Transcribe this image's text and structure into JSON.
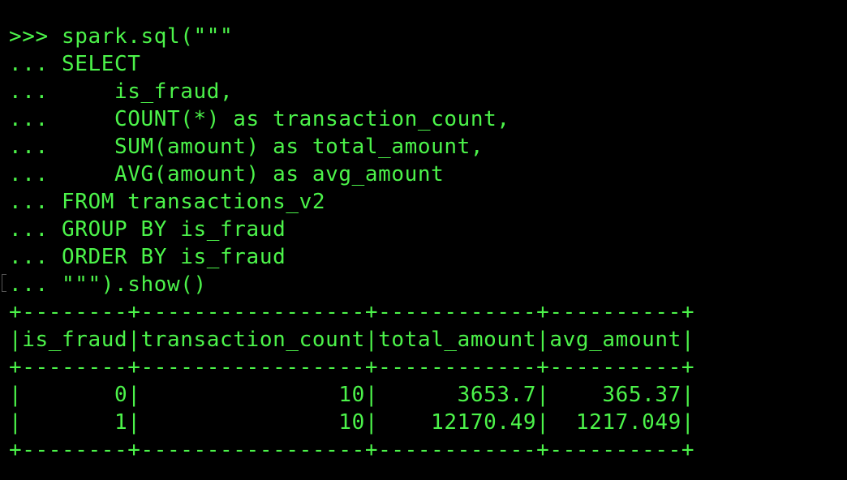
{
  "terminal": {
    "text_color": "#4cf34a",
    "background_color": "#000000",
    "lines": [
      ">>> spark.sql(\"\"\"",
      "... SELECT",
      "...     is_fraud,",
      "...     COUNT(*) as transaction_count,",
      "...     SUM(amount) as total_amount,",
      "...     AVG(amount) as avg_amount",
      "... FROM transactions_v2",
      "... GROUP BY is_fraud",
      "... ORDER BY is_fraud",
      "... \"\"\").show()",
      "+--------+-----------------+------------+----------+",
      "|is_fraud|transaction_count|total_amount|avg_amount|",
      "+--------+-----------------+------------+----------+",
      "|       0|               10|      3653.7|    365.37|",
      "|       1|               10|    12170.49|  1217.049|",
      "+--------+-----------------+------------+----------+"
    ]
  }
}
